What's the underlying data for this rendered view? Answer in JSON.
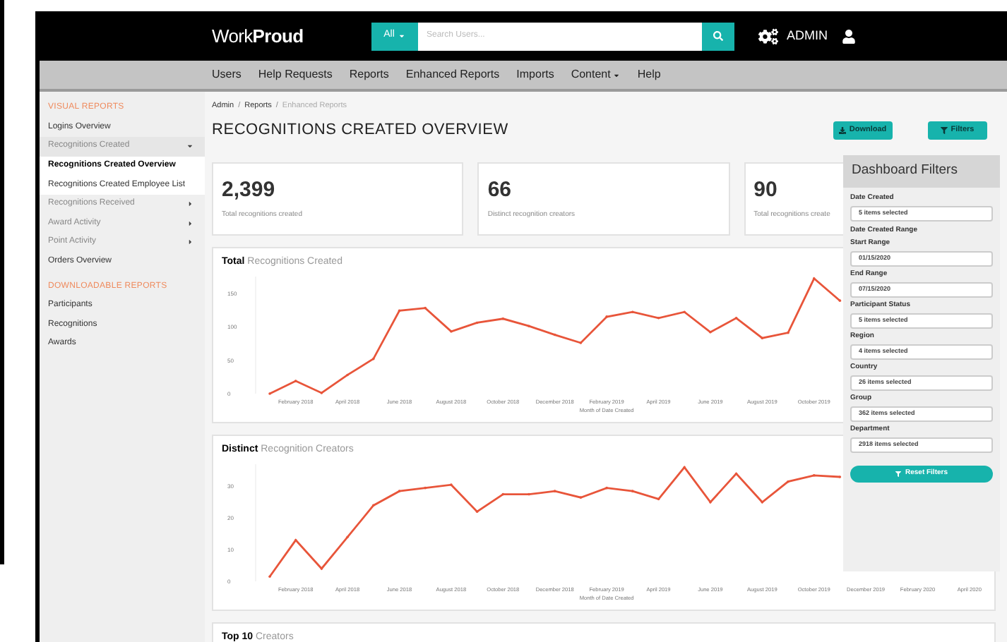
{
  "header": {
    "logo": "Work**Proud**",
    "search": {
      "scope": "All",
      "placeholder": "Search Users..."
    },
    "user": "ADMIN"
  },
  "nav": [
    {
      "label": "Users",
      "dropdown": false
    },
    {
      "label": "Help Requests",
      "dropdown": false
    },
    {
      "label": "Reports",
      "dropdown": false
    },
    {
      "label": "Enhanced Reports",
      "dropdown": false
    },
    {
      "label": "Imports",
      "dropdown": false
    },
    {
      "label": "Content",
      "dropdown": true
    },
    {
      "label": "Help",
      "dropdown": false
    }
  ],
  "sidebar": [
    {
      "title": "VISUAL REPORTS",
      "items": [
        {
          "label": "Logins Overview",
          "selected": false
        },
        {
          "label": "Recognitions Created",
          "selected": false,
          "expanded": true,
          "children": [
            {
              "label": "Recognitions Created Overview",
              "selected": true
            },
            {
              "label": "Recognitions Created Employee List",
              "selected": false
            }
          ]
        },
        {
          "label": "Recognitions Received",
          "selected": false,
          "expanded": false
        },
        {
          "label": "Award Activity",
          "selected": false,
          "expanded": false
        },
        {
          "label": "Point Activity",
          "selected": false,
          "expanded": false
        },
        {
          "label": "Orders Overview",
          "selected": false
        }
      ]
    },
    {
      "title": "DOWNLOADABLE REPORTS",
      "items": [
        {
          "label": "Participants",
          "selected": false
        },
        {
          "label": "Recognitions",
          "selected": false
        },
        {
          "label": "Awards",
          "selected": false
        }
      ]
    }
  ],
  "breadcrumb": [
    {
      "label": "Admin",
      "current": false
    },
    {
      "separator": "/",
      "label": "Reports",
      "current": false
    },
    {
      "separator": "/",
      "label": "Enhanced Reports",
      "current": true
    }
  ],
  "title": "RECOGNITIONS CREATED OVERVIEW",
  "actions": [
    {
      "kind": "download",
      "label": "Download"
    },
    {
      "kind": "filter",
      "label": "Filters"
    }
  ],
  "stats": [
    {
      "value": "2,399",
      "label": "Total recognitions created"
    },
    {
      "value": "66",
      "label": "Distinct recognition creators"
    },
    {
      "value": "90",
      "label": "Total recognitions create"
    }
  ],
  "charts": [
    {
      "chart_data": {
        "type": "line",
        "title": "**Total** Recognitions Created",
        "xlabel": "Month of Date Created",
        "ylim": [
          0,
          175
        ],
        "yticks": [
          0,
          50,
          100,
          150
        ],
        "categories": [
          null,
          "February 2018",
          null,
          "April 2018",
          null,
          "June 2018",
          null,
          "August 2018",
          null,
          "October 2018",
          null,
          "December 2018",
          null,
          "February 2019",
          null,
          "April 2019",
          null,
          "June 2019",
          null,
          "August 2019",
          null,
          "October 2019",
          null,
          null,
          null,
          null,
          null,
          null
        ],
        "series": [
          {
            "color": "#e8553a",
            "values": [
              0,
              19,
              1,
              28,
              52,
              124,
              128,
              93,
              106,
              112,
              101,
              88,
              76,
              115,
              122,
              113,
              122,
              92,
              113,
              83,
              91,
              172,
              139,
              null,
              null,
              null,
              null,
              null
            ]
          }
        ]
      }
    },
    {
      "chart_data": {
        "type": "line",
        "title": "**Distinct** Recognition Creators",
        "xlabel": "Month of Date Created",
        "ylim": [
          0,
          37
        ],
        "yticks": [
          0,
          10,
          20,
          30
        ],
        "categories": [
          null,
          "February 2018",
          null,
          "April 2018",
          null,
          "June 2018",
          null,
          "August 2018",
          null,
          "October 2018",
          null,
          "December 2018",
          null,
          "February 2019",
          null,
          "April 2019",
          null,
          "June 2019",
          null,
          "August 2019",
          null,
          "October 2019",
          null,
          "December 2019",
          null,
          "February 2020",
          null,
          "April 2020"
        ],
        "series": [
          {
            "color": "#e8553a",
            "values": [
              1.5,
              13,
              4,
              14,
              24,
              28.5,
              29.5,
              30.5,
              22,
              27.5,
              27.5,
              28.5,
              26.5,
              29.5,
              28.5,
              26,
              36,
              25,
              34,
              25,
              31.5,
              33.5,
              33,
              null,
              null,
              null,
              null,
              null
            ]
          }
        ]
      }
    }
  ],
  "top_card": {
    "title": "**Top 10** Creators"
  },
  "filters": {
    "title": "Dashboard Filters",
    "items": [
      {
        "kind": "field",
        "label": "Date Created",
        "value": "5 items selected"
      },
      {
        "kind": "heading",
        "label": "Date Created Range"
      },
      {
        "kind": "field",
        "label": "Start Range",
        "value": "01/15/2020"
      },
      {
        "kind": "field",
        "label": "End Range",
        "value": "07/15/2020"
      },
      {
        "kind": "field",
        "label": "Participant Status",
        "value": "5 items selected"
      },
      {
        "kind": "field",
        "label": "Region",
        "value": "4 items selected"
      },
      {
        "kind": "field",
        "label": "Country",
        "value": "26 items selected"
      },
      {
        "kind": "field",
        "label": "Group",
        "value": "362 items selected"
      },
      {
        "kind": "field",
        "label": "Department",
        "value": "2918 items selected"
      }
    ],
    "reset": "Reset Filters"
  }
}
